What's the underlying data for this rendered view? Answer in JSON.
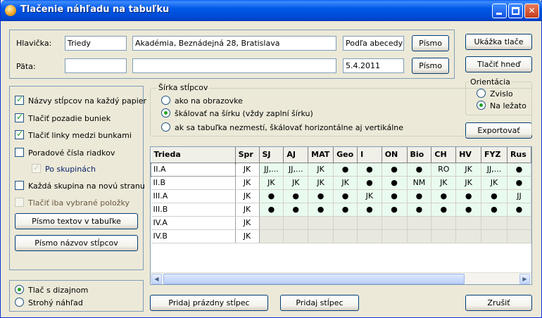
{
  "window": {
    "title": "Tlačenie náhľadu na tabuľku",
    "min_glyph": "",
    "max_glyph": "",
    "close_glyph": "✕"
  },
  "header_row": {
    "label": "Hlavička:",
    "left_value": "Triedy",
    "center_value": "Akadémia, Beznádejná 28, Bratislava",
    "right_value": "Podľa abecedy",
    "font_button": "Písmo"
  },
  "footer_row": {
    "label": "Päta:",
    "left_value": "",
    "center_value": "",
    "right_value": "5.4.2011",
    "font_button": "Písmo"
  },
  "right_buttons": {
    "preview": "Ukážka tlače",
    "print_now": "Tlačiť hneď",
    "export": "Exportovať",
    "cancel": "Zrušiť"
  },
  "orientation": {
    "title": "Orientácia",
    "options": [
      {
        "label": "Zvislo",
        "selected": false
      },
      {
        "label": "Na ležato",
        "selected": true
      }
    ]
  },
  "column_width": {
    "title": "Šírka stĺpcov",
    "options": [
      {
        "label": "ako na obrazovke",
        "selected": false
      },
      {
        "label": "škálovať na šírku (vždy zaplní šírku)",
        "selected": true
      },
      {
        "label": "ak sa tabuľka nezmestí, škálovať horizontálne aj vertikálne",
        "selected": false
      }
    ]
  },
  "options": {
    "items": [
      {
        "label": "Názvy stĺpcov na každý papier",
        "checked": true
      },
      {
        "label": "Tlačiť pozadie buniek",
        "checked": true
      },
      {
        "label": "Tlačiť linky medzi bunkami",
        "checked": true
      },
      {
        "label": "Poradové čísla riadkov",
        "checked": false
      },
      {
        "label": "Po skupinách",
        "checked": true
      },
      {
        "label": "Každá skupina na novú stranu",
        "checked": false
      },
      {
        "label": "Tlačiť iba vybrané položky",
        "checked": false
      }
    ],
    "table_font_button": "Písmo textov v tabuľke",
    "column_font_button": "Písmo názvov stĺpcov"
  },
  "print_mode": {
    "options": [
      {
        "label": "Tlač s dizajnom",
        "selected": true
      },
      {
        "label": "Strohý náhľad",
        "selected": false
      }
    ]
  },
  "bottom_buttons": {
    "add_empty_column": "Pridaj prázdny stĺpec",
    "add_column": "Pridaj stĺpec"
  },
  "grid": {
    "columns": [
      "Trieda",
      "Spr",
      "SJ",
      "AJ",
      "MAT",
      "Geo",
      "I",
      "ON",
      "Bio",
      "CH",
      "HV",
      "FYZ",
      "Rus"
    ],
    "rows": [
      [
        "II.A",
        "JK",
        "JJ,...",
        "JJ,...",
        "JK",
        "●",
        "●",
        "●",
        "●",
        "RO",
        "JK",
        "JJ,...",
        "●"
      ],
      [
        "II.B",
        "JK",
        "JK",
        "JK",
        "JK",
        "JK",
        "●",
        "●",
        "NM",
        "JK",
        "JK",
        "JK",
        "●"
      ],
      [
        "III.A",
        "JK",
        "●",
        "●",
        "●",
        "●",
        "JK",
        "●",
        "●",
        "●",
        "●",
        "●",
        "JJ"
      ],
      [
        "III.B",
        "JK",
        "●",
        "●",
        "●",
        "●",
        "●",
        "●",
        "●",
        "●",
        "●",
        "●",
        "●"
      ],
      [
        "IV.A",
        "JK",
        "",
        "",
        "",
        "",
        "",
        "",
        "",
        "",
        "",
        "",
        ""
      ],
      [
        "IV.B",
        "JK",
        "",
        "",
        "",
        "",
        "",
        "",
        "",
        "",
        "",
        "",
        ""
      ]
    ],
    "scroll_left": "◀",
    "scroll_right": "▶"
  }
}
